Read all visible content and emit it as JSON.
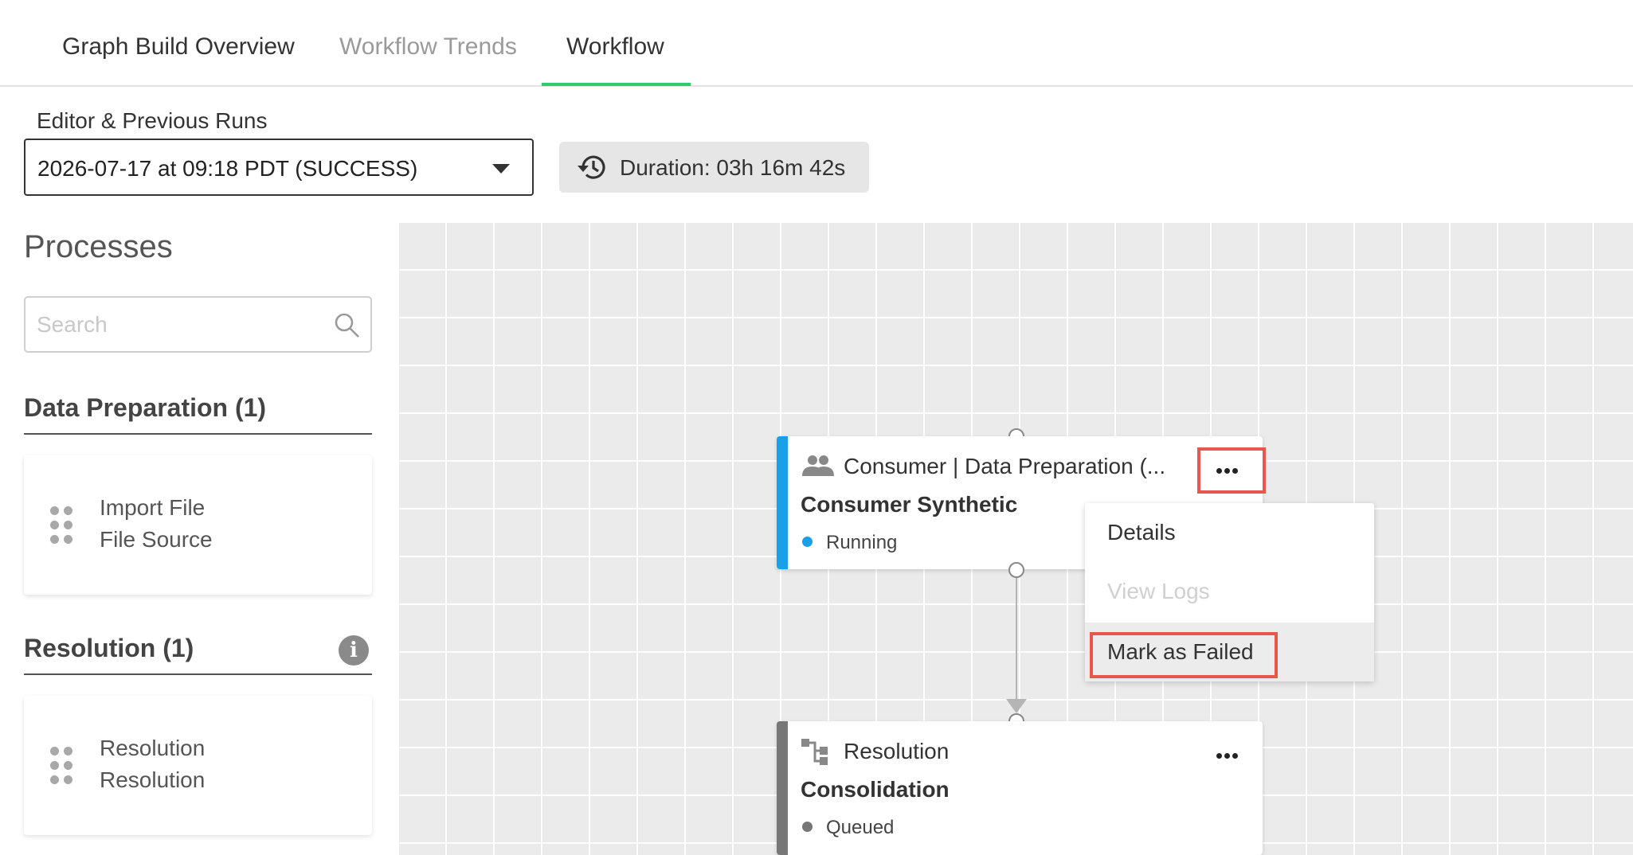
{
  "tabs": {
    "graph_build_overview": "Graph Build Overview",
    "workflow_trends": "Workflow Trends",
    "workflow": "Workflow",
    "active_color": "#2ecc71"
  },
  "runs": {
    "label": "Editor & Previous Runs",
    "selected": "2026-07-17 at 09:18 PDT (SUCCESS)",
    "duration": "Duration: 03h 16m 42s"
  },
  "processes": {
    "title": "Processes",
    "search_placeholder": "Search",
    "sections": [
      {
        "title": "Data Preparation (1)",
        "items": [
          {
            "line1": "Import File",
            "line2": "File Source"
          }
        ]
      },
      {
        "title": "Resolution (1)",
        "items": [
          {
            "line1": "Resolution",
            "line2": "Resolution"
          }
        ]
      }
    ]
  },
  "nodes": [
    {
      "header": "Consumer | Data Preparation (...",
      "name": "Consumer Synthetic",
      "status": "Running",
      "status_color": "#1aa0e8",
      "bar_color": "#1aa0e8",
      "icon": "users-icon"
    },
    {
      "header": "Resolution",
      "name": "Consolidation",
      "status": "Queued",
      "status_color": "#777777",
      "bar_color": "#777777",
      "icon": "flow-icon"
    }
  ],
  "context_menu": {
    "details": "Details",
    "view_logs": "View Logs",
    "mark_as_failed": "Mark as Failed"
  },
  "highlight_color": "#e8574b"
}
